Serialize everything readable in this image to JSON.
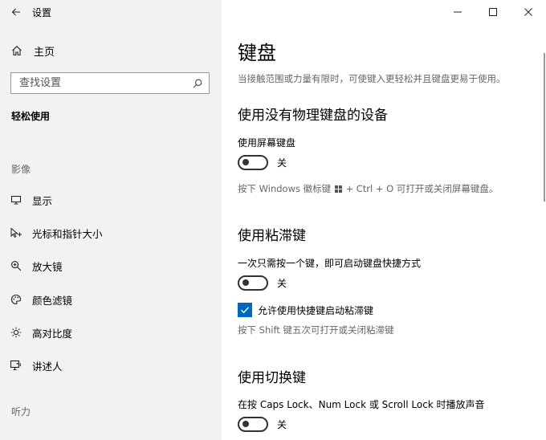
{
  "sidebar": {
    "app_title": "设置",
    "home_label": "主页",
    "search_placeholder": "查找设置",
    "section_title": "轻松使用",
    "group_vision": "影像",
    "items": [
      {
        "label": "显示",
        "icon": "display-icon"
      },
      {
        "label": "光标和指针大小",
        "icon": "pointer-icon"
      },
      {
        "label": "放大镜",
        "icon": "magnifier-icon"
      },
      {
        "label": "颜色滤镜",
        "icon": "palette-icon"
      },
      {
        "label": "高对比度",
        "icon": "brightness-icon"
      },
      {
        "label": "讲述人",
        "icon": "narrator-icon"
      }
    ],
    "group_hearing": "听力"
  },
  "main": {
    "title": "键盘",
    "description": "当接触范围或力量有限时，可使键入更轻松并且键盘更易于使用。",
    "sections": {
      "no_keyboard": {
        "heading": "使用没有物理键盘的设备",
        "onscreen_label": "使用屏幕键盘",
        "onscreen_state": "关",
        "hint_pre": "按下 Windows 徽标键",
        "hint_post": "+ Ctrl + O 可打开或关闭屏幕键盘。"
      },
      "sticky": {
        "heading": "使用粘滞键",
        "label": "一次只需按一个键，即可启动键盘快捷方式",
        "state": "关",
        "checkbox_label": "允许使用快捷键启动粘滞键",
        "checkbox_checked": true,
        "hint": "按下 Shift 键五次可打开或关闭粘滞键"
      },
      "toggle_keys": {
        "heading": "使用切换键",
        "label": "在按 Caps Lock、Num Lock 或 Scroll Lock 时播放声音",
        "state": "关"
      }
    }
  },
  "colors": {
    "sidebar_bg": "#f2f2f2",
    "accent": "#0067c0"
  }
}
